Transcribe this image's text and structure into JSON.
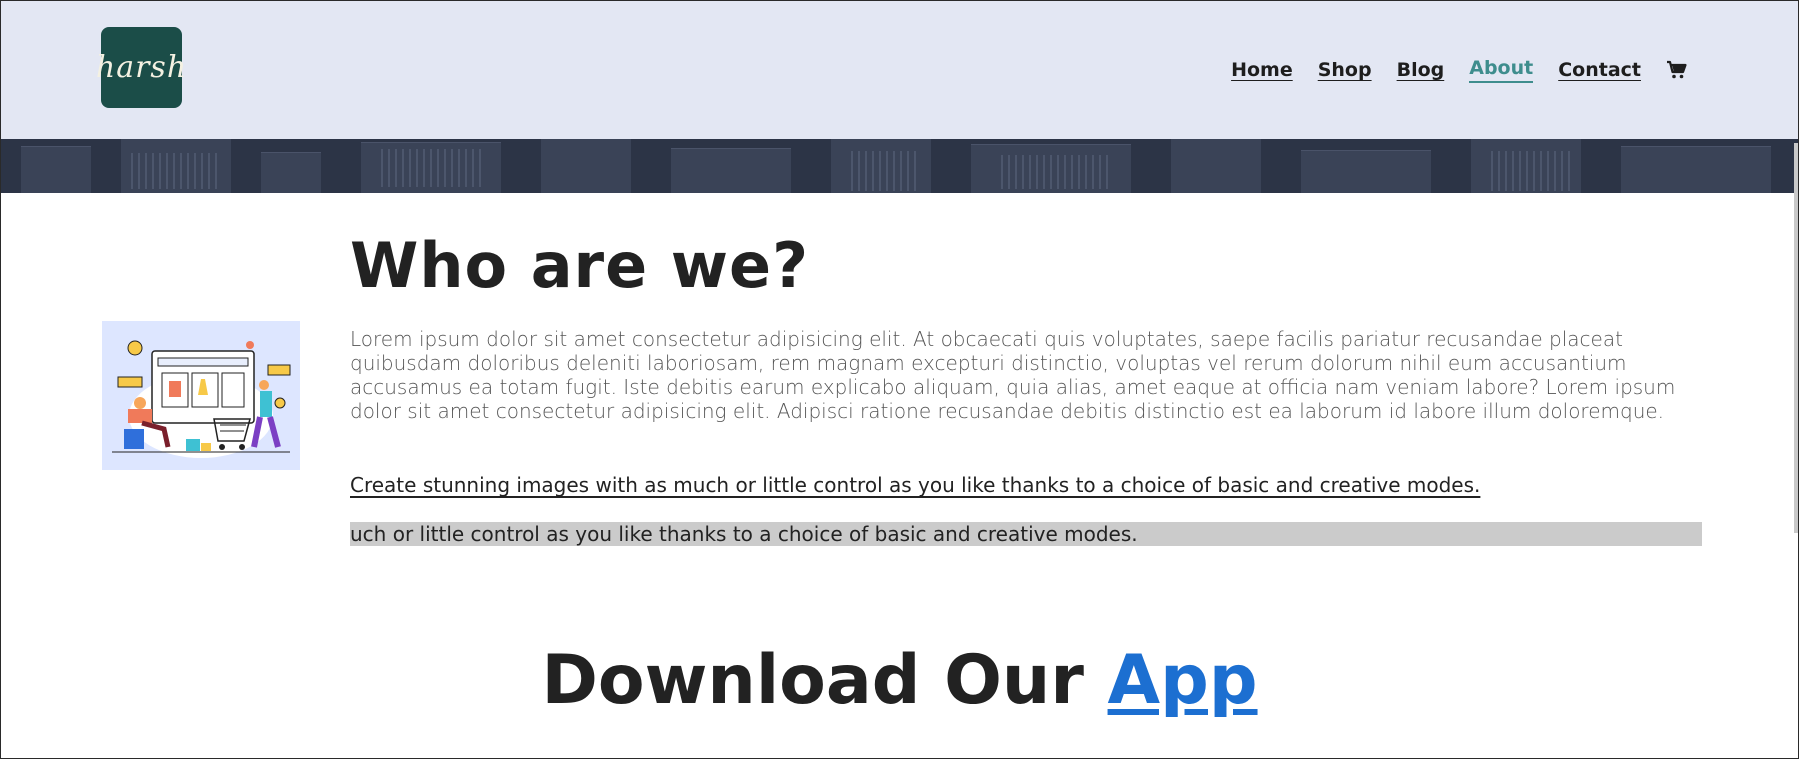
{
  "header": {
    "logo_text": "harsh",
    "nav": [
      {
        "label": "Home",
        "active": false
      },
      {
        "label": "Shop",
        "active": false
      },
      {
        "label": "Blog",
        "active": false
      },
      {
        "label": "About",
        "active": true
      },
      {
        "label": "Contact",
        "active": false
      }
    ],
    "cart_icon": "cart-icon"
  },
  "about": {
    "heading": "Who are we?",
    "paragraph": "Lorem ipsum dolor sit amet consectetur adipisicing elit. At obcaecati quis voluptates, saepe facilis pariatur recusandae placeat quibusdam doloribus deleniti laboriosam, rem magnam excepturi distinctio, voluptas vel rerum dolorum nihil eum accusantium accusamus ea totam fugit. Iste debitis earum explicabo aliquam, quia alias, amet eaque at officia nam veniam labore? Lorem ipsum dolor sit amet consectetur adipisicing elit. Adipisci ratione recusandae debitis distinctio est ea laborum id labore illum doloremque.",
    "link_text": "Create stunning images with as much or little control as you like thanks to a choice of basic and creative modes.",
    "selected_text": "uch or little control as you like thanks to a choice of basic and creative modes."
  },
  "download": {
    "prefix": "Download Our ",
    "app": "App"
  },
  "colors": {
    "header_bg": "#e3e7f3",
    "logo_bg": "#1b4d48",
    "active_nav": "#3e8d8d",
    "app_link": "#1c6fd1",
    "banner_bg": "#2c3446",
    "selection_bg": "#cbcbcb"
  }
}
